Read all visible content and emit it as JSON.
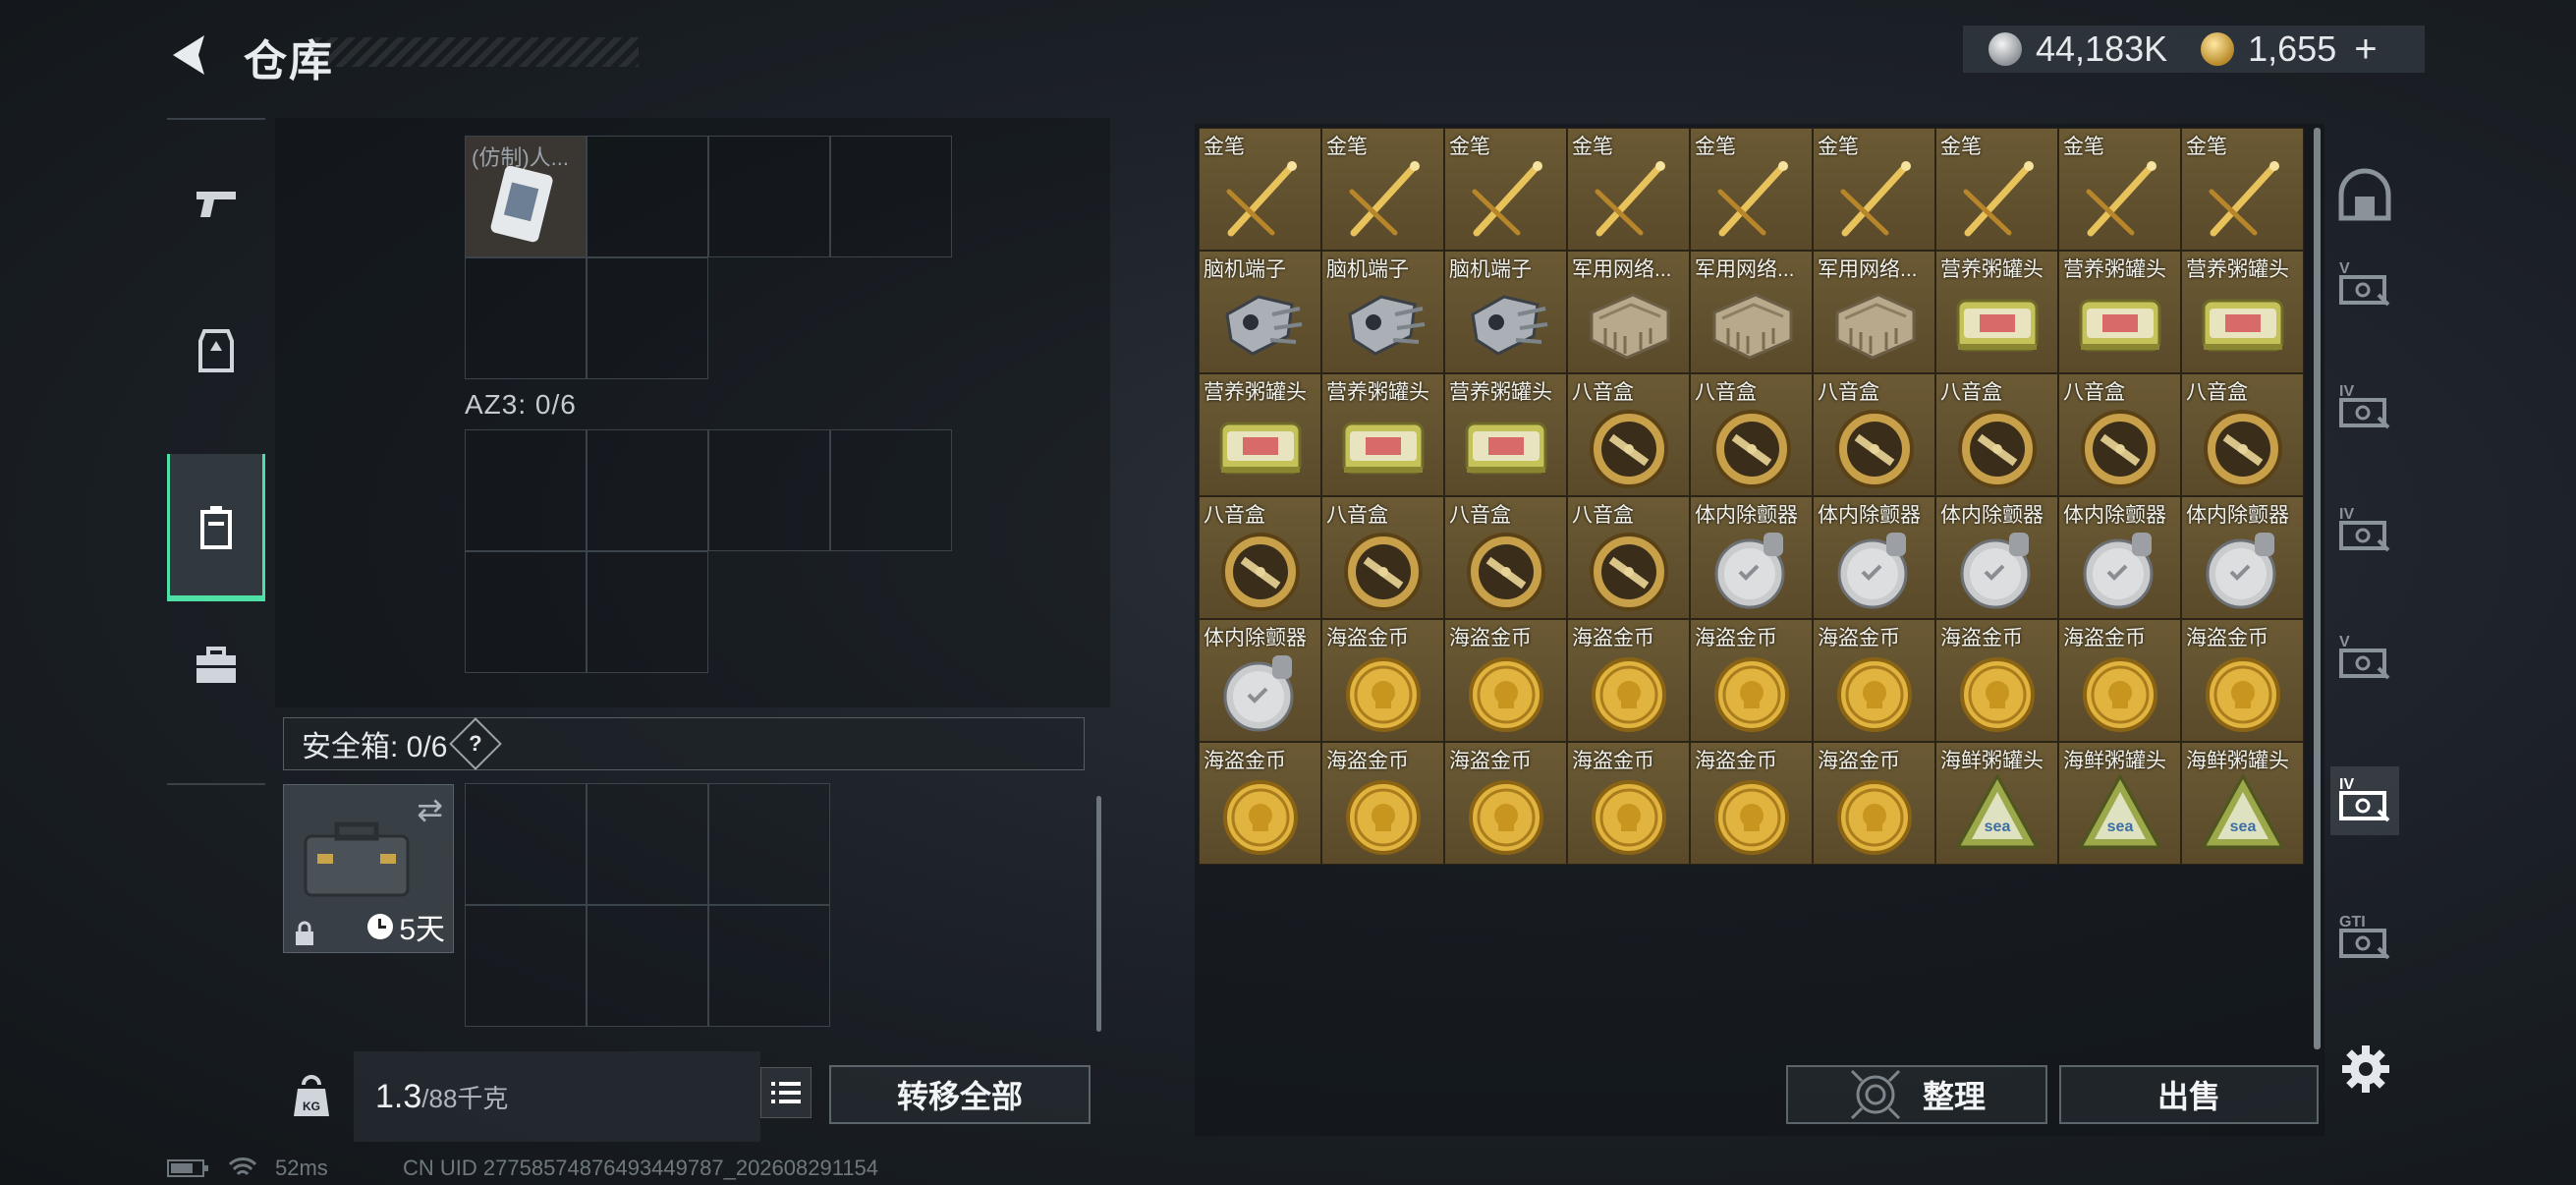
{
  "header": {
    "title": "仓库",
    "currency": [
      {
        "icon": "silver-coin-icon",
        "value": "44,183K"
      },
      {
        "icon": "gold-coin-icon",
        "value": "1,655"
      }
    ],
    "add_label": "+"
  },
  "rail": [
    {
      "icon": "pistol-icon",
      "active": false
    },
    {
      "icon": "armor-vest-icon",
      "active": false
    },
    {
      "icon": "backpack-icon",
      "active": true
    },
    {
      "icon": "briefcase-icon",
      "active": false
    }
  ],
  "backpack": {
    "ticket_label": "(仿制)人...",
    "az3_label": "AZ3: 0/6",
    "safe_label": "安全箱: 0/6",
    "safe_help": "?",
    "safe_days": "5天"
  },
  "footer_left": {
    "weight_icon_label": "KG",
    "weight_value": "1.3",
    "weight_capacity": "/88千克",
    "transfer_label": "转移全部"
  },
  "warehouse": {
    "rows": [
      [
        {
          "label": "金笔",
          "icon": "gold-pen-icon"
        },
        {
          "label": "金笔",
          "icon": "gold-pen-icon"
        },
        {
          "label": "金笔",
          "icon": "gold-pen-icon"
        },
        {
          "label": "金笔",
          "icon": "gold-pen-icon"
        },
        {
          "label": "金笔",
          "icon": "gold-pen-icon"
        },
        {
          "label": "金笔",
          "icon": "gold-pen-icon"
        },
        {
          "label": "金笔",
          "icon": "gold-pen-icon"
        },
        {
          "label": "金笔",
          "icon": "gold-pen-icon"
        },
        {
          "label": "金笔",
          "icon": "gold-pen-icon"
        }
      ],
      [
        {
          "label": "脑机端子",
          "icon": "brain-terminal-icon"
        },
        {
          "label": "脑机端子",
          "icon": "brain-terminal-icon"
        },
        {
          "label": "脑机端子",
          "icon": "brain-terminal-icon"
        },
        {
          "label": "军用网络...",
          "icon": "military-network-icon"
        },
        {
          "label": "军用网络...",
          "icon": "military-network-icon"
        },
        {
          "label": "军用网络...",
          "icon": "military-network-icon"
        },
        {
          "label": "营养粥罐头",
          "icon": "porridge-can-icon"
        },
        {
          "label": "营养粥罐头",
          "icon": "porridge-can-icon"
        },
        {
          "label": "营养粥罐头",
          "icon": "porridge-can-icon"
        }
      ],
      [
        {
          "label": "营养粥罐头",
          "icon": "porridge-can-icon"
        },
        {
          "label": "营养粥罐头",
          "icon": "porridge-can-icon"
        },
        {
          "label": "营养粥罐头",
          "icon": "porridge-can-icon"
        },
        {
          "label": "八音盒",
          "icon": "music-box-icon"
        },
        {
          "label": "八音盒",
          "icon": "music-box-icon"
        },
        {
          "label": "八音盒",
          "icon": "music-box-icon"
        },
        {
          "label": "八音盒",
          "icon": "music-box-icon"
        },
        {
          "label": "八音盒",
          "icon": "music-box-icon"
        },
        {
          "label": "八音盒",
          "icon": "music-box-icon"
        }
      ],
      [
        {
          "label": "八音盒",
          "icon": "music-box-icon"
        },
        {
          "label": "八音盒",
          "icon": "music-box-icon"
        },
        {
          "label": "八音盒",
          "icon": "music-box-icon"
        },
        {
          "label": "八音盒",
          "icon": "music-box-icon"
        },
        {
          "label": "体内除颤器",
          "icon": "defibrillator-icon"
        },
        {
          "label": "体内除颤器",
          "icon": "defibrillator-icon"
        },
        {
          "label": "体内除颤器",
          "icon": "defibrillator-icon"
        },
        {
          "label": "体内除颤器",
          "icon": "defibrillator-icon"
        },
        {
          "label": "体内除颤器",
          "icon": "defibrillator-icon"
        }
      ],
      [
        {
          "label": "体内除颤器",
          "icon": "defibrillator-icon"
        },
        {
          "label": "海盗金币",
          "icon": "pirate-coin-icon"
        },
        {
          "label": "海盗金币",
          "icon": "pirate-coin-icon"
        },
        {
          "label": "海盗金币",
          "icon": "pirate-coin-icon"
        },
        {
          "label": "海盗金币",
          "icon": "pirate-coin-icon"
        },
        {
          "label": "海盗金币",
          "icon": "pirate-coin-icon"
        },
        {
          "label": "海盗金币",
          "icon": "pirate-coin-icon"
        },
        {
          "label": "海盗金币",
          "icon": "pirate-coin-icon"
        },
        {
          "label": "海盗金币",
          "icon": "pirate-coin-icon"
        }
      ],
      [
        {
          "label": "海盗金币",
          "icon": "pirate-coin-icon"
        },
        {
          "label": "海盗金币",
          "icon": "pirate-coin-icon"
        },
        {
          "label": "海盗金币",
          "icon": "pirate-coin-icon"
        },
        {
          "label": "海盗金币",
          "icon": "pirate-coin-icon"
        },
        {
          "label": "海盗金币",
          "icon": "pirate-coin-icon"
        },
        {
          "label": "海盗金币",
          "icon": "pirate-coin-icon"
        },
        {
          "label": "海鲜粥罐头",
          "icon": "seafood-can-icon"
        },
        {
          "label": "海鲜粥罐头",
          "icon": "seafood-can-icon"
        },
        {
          "label": "海鲜粥罐头",
          "icon": "seafood-can-icon"
        }
      ]
    ],
    "sort_label": "整理",
    "sell_label": "出售"
  },
  "right_tabs": [
    {
      "icon": "home-vault-icon",
      "text": ""
    },
    {
      "icon": "container-v-icon",
      "text": "V"
    },
    {
      "icon": "container-iv-folder-icon",
      "text": "IV"
    },
    {
      "icon": "container-iv-triangle-icon",
      "text": "IV"
    },
    {
      "icon": "container-v-b-icon",
      "text": "V"
    },
    {
      "icon": "container-iv-active-icon",
      "text": "IV"
    },
    {
      "icon": "container-gti-icon",
      "text": "GTI"
    }
  ],
  "status": {
    "ping": "52ms",
    "uid": "CN UID 27758574876493449787_202608291154"
  },
  "colors": {
    "accent": "#4fe0a6",
    "slot_bg": "#6b5a34"
  }
}
